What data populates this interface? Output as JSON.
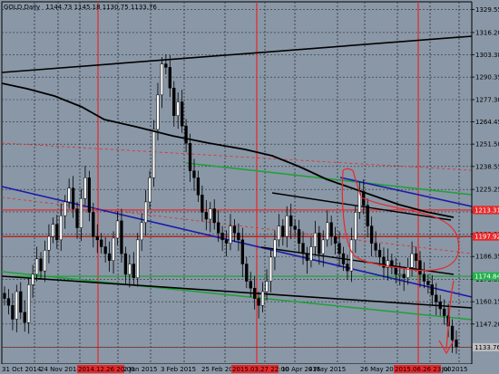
{
  "header": {
    "symbol": "GOLD,Daily",
    "ohlc": "1144.73 1145.18 1130.75 1133.76"
  },
  "price_axis": {
    "labels": [
      "1329.55",
      "1316.20",
      "1303.38",
      "1290.35",
      "1277.30",
      "1264.45",
      "1251.50",
      "1238.55",
      "1225.25",
      "1212.21",
      "1199.39",
      "1186.35",
      "1173.05",
      "1160.15",
      "1147.20",
      "1133.76"
    ]
  },
  "time_axis": {
    "labels": [
      "31 Oct 2014",
      "24 Nov 2014",
      "2014.12.26 20:00",
      "2 Jan 2015",
      "3 Feb 2015",
      "25 Feb 2015",
      "2015.03.27 22:00",
      "10 Apr 2015",
      "4 May 2015",
      "26 May 2015",
      "2015.06.26 23:00",
      "Jul 2015"
    ]
  },
  "price_markers": [
    {
      "value": "1213.31",
      "color": "#e8282a"
    },
    {
      "value": "1197.92",
      "color": "#e8282a"
    },
    {
      "value": "1174.84",
      "color": "#22b14c"
    },
    {
      "value": "1133.76",
      "color": "#c0c0c0"
    }
  ],
  "colors": {
    "background": "#8a97a6",
    "grid": "#2a2f36",
    "candle": "#000000",
    "ma": "#000000",
    "red": "#e8282a",
    "green": "#22a03c",
    "blue": "#1a1aa8"
  },
  "chart_data": {
    "type": "candlestick",
    "title": "GOLD,Daily",
    "ylim": [
      1124,
      1334
    ],
    "series": [
      {
        "name": "GOLD",
        "values": [
          1162,
          1158,
          1150,
          1166,
          1154,
          1148,
          1170,
          1176,
          1185,
          1178,
          1190,
          1198,
          1205,
          1196,
          1210,
          1218,
          1226,
          1214,
          1203,
          1220,
          1232,
          1212,
          1198,
          1196,
          1192,
          1188,
          1184,
          1197,
          1207,
          1188,
          1176,
          1182,
          1174,
          1196,
          1206,
          1218,
          1232,
          1260,
          1280,
          1298,
          1296,
          1284,
          1268,
          1276,
          1262,
          1252,
          1236,
          1232,
          1222,
          1212,
          1208,
          1214,
          1206,
          1200,
          1196,
          1194,
          1204,
          1200,
          1196,
          1182,
          1172,
          1168,
          1162,
          1158,
          1166,
          1172,
          1186,
          1196,
          1204,
          1198,
          1210,
          1204,
          1202,
          1194,
          1188,
          1184,
          1192,
          1200,
          1188,
          1196,
          1206,
          1198,
          1194,
          1188,
          1182,
          1178,
          1196,
          1212,
          1224,
          1216,
          1204,
          1194,
          1190,
          1186,
          1180,
          1184,
          1180,
          1176,
          1176,
          1174,
          1180,
          1188,
          1184,
          1176,
          1172,
          1170,
          1164,
          1160,
          1156,
          1152,
          1146,
          1138,
          1134
        ]
      }
    ]
  }
}
